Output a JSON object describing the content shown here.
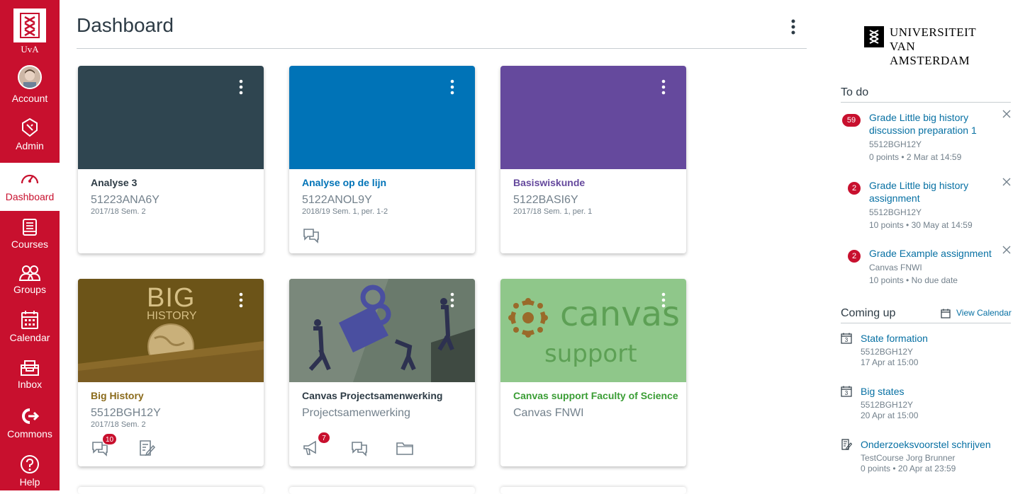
{
  "nav": {
    "logo_text": "UvA",
    "items": [
      {
        "label": "Account"
      },
      {
        "label": "Admin"
      },
      {
        "label": "Dashboard"
      },
      {
        "label": "Courses"
      },
      {
        "label": "Groups"
      },
      {
        "label": "Calendar"
      },
      {
        "label": "Inbox"
      },
      {
        "label": "Commons"
      },
      {
        "label": "Help"
      }
    ]
  },
  "page": {
    "title": "Dashboard"
  },
  "cards": [
    {
      "name": "Analyse 3",
      "code": "51223ANA6Y",
      "term": "2017/18 Sem. 2",
      "color": "#2f4550",
      "name_color": "#2d3b45"
    },
    {
      "name": "Analyse op de lijn",
      "code": "5122ANOL9Y",
      "term": "2018/19 Sem. 1, per. 1-2",
      "color": "#0073b7",
      "name_color": "#0073b7"
    },
    {
      "name": "Basiswiskunde",
      "code": "5122BASI6Y",
      "term": "2017/18 Sem. 1, per. 1",
      "color": "#65499d",
      "name_color": "#65499d"
    },
    {
      "name": "Big History",
      "code": "5512BGH12Y",
      "term": "2017/18 Sem. 2",
      "color": "#8a6a1a",
      "name_color": "#8a6a1a",
      "hero_title_1": "BIG",
      "hero_title_2": "HISTORY",
      "discussion_badge": "10"
    },
    {
      "name": "Canvas Projectsamenwerking",
      "code": "Projectsamenwerking",
      "term": "",
      "color": "#5b6c5e",
      "name_color": "#2d3b45",
      "announcement_badge": "7"
    },
    {
      "name": "Canvas support Faculty of Science",
      "code": "Canvas FNWI",
      "term": "",
      "color": "#8fc78a",
      "name_color": "#3a9d35",
      "hero_title_1": "canvas",
      "hero_title_2": "support"
    }
  ],
  "branding": {
    "line1": "UNIVERSITEIT",
    "line2": "VAN AMSTERDAM"
  },
  "todo": {
    "heading": "To do",
    "items": [
      {
        "badge": "59",
        "title": "Grade Little big history discussion preparation 1",
        "course": "5512BGH12Y",
        "meta": "0 points • 2 Mar at 14:59"
      },
      {
        "badge": "2",
        "title": "Grade Little big history assignment",
        "course": "5512BGH12Y",
        "meta": "10 points • 30 May at 14:59"
      },
      {
        "badge": "2",
        "title": "Grade Example assignment",
        "course": "Canvas FNWI",
        "meta": "10 points • No due date"
      }
    ]
  },
  "coming_up": {
    "heading": "Coming up",
    "view_calendar": "View Calendar",
    "items": [
      {
        "title": "State formation",
        "course": "5512BGH12Y",
        "meta": "17 Apr at 15:00",
        "icon": "calendar-icon",
        "day": "3"
      },
      {
        "title": "Big states",
        "course": "5512BGH12Y",
        "meta": "20 Apr at 15:00",
        "icon": "calendar-icon",
        "day": "3"
      },
      {
        "title": "Onderzoeksvoorstel schrijven",
        "course": "TestCourse Jorg Brunner",
        "meta": "0 points • 20 Apr at 23:59",
        "icon": "assignment-icon"
      }
    ]
  }
}
